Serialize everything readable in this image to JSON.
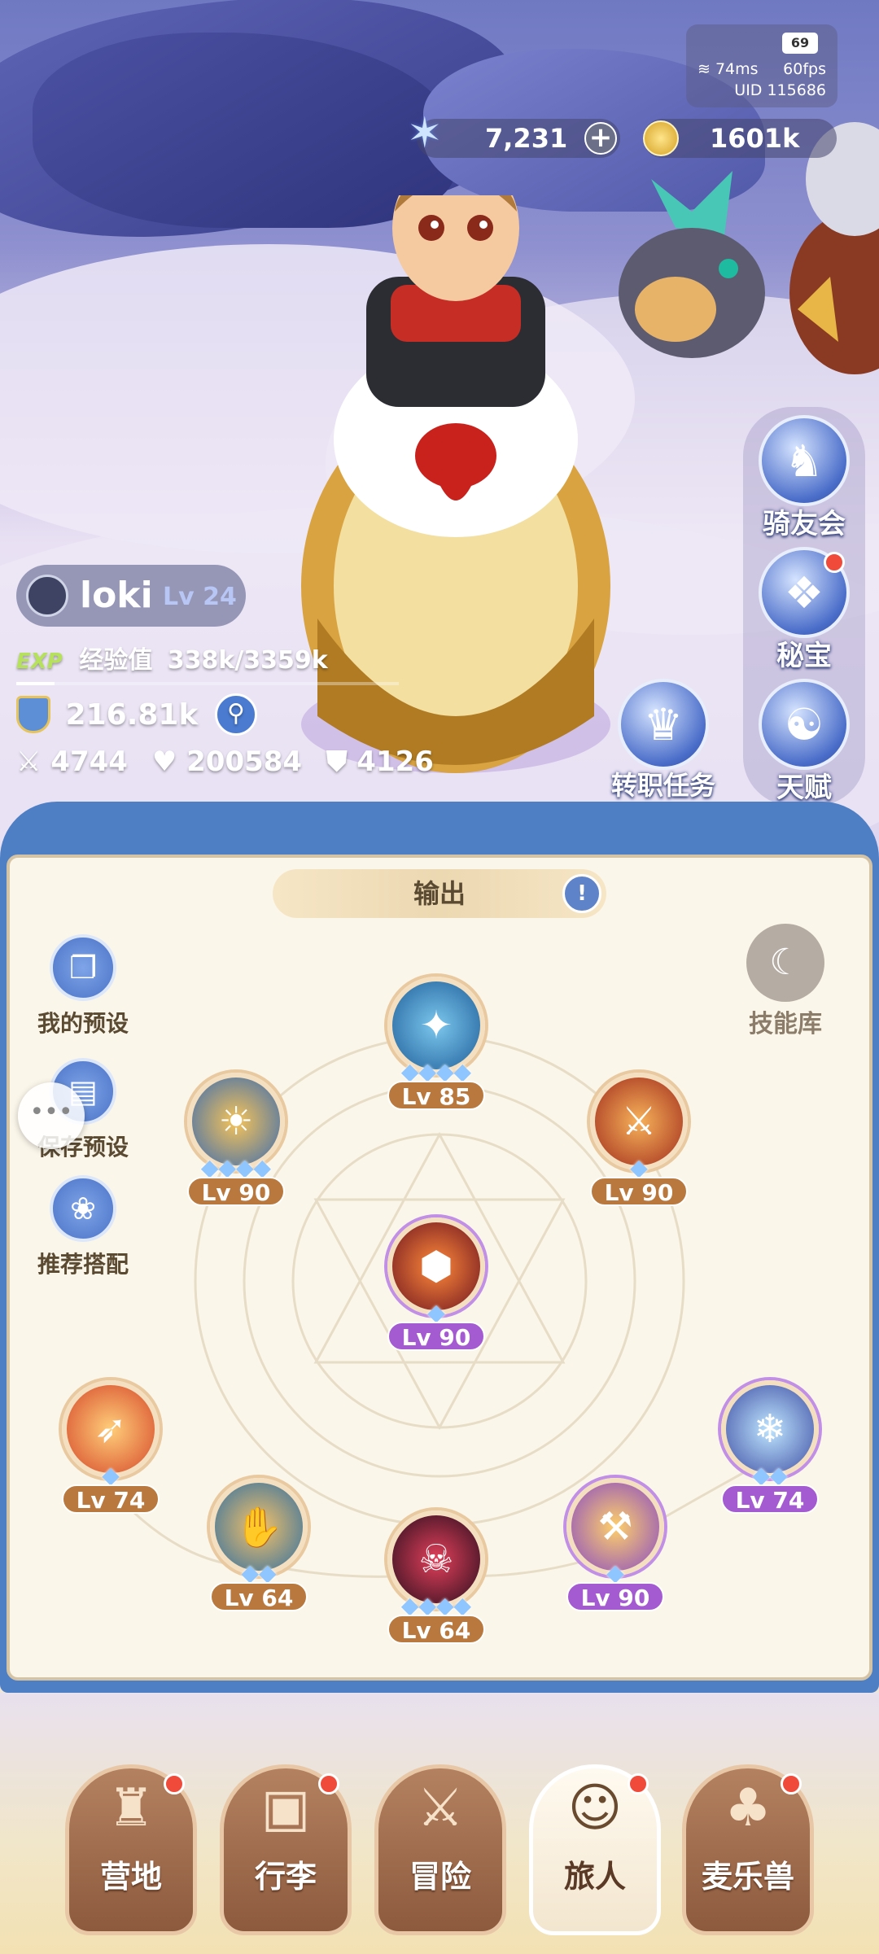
{
  "hud": {
    "battery": "69",
    "ping": "74ms",
    "fps": "60fps",
    "uid": "UID 115686",
    "gems": "7,231",
    "gold": "1601k"
  },
  "player": {
    "name": "loki",
    "level": "Lv 24",
    "exp_tag": "EXP",
    "exp_label": "经验值",
    "exp_value": "338k/3359k",
    "power": "216.81k",
    "attack": "4744",
    "hp": "200584",
    "defense": "4126"
  },
  "right_menu": [
    {
      "label": "骑友会",
      "icon": "horse-icon"
    },
    {
      "label": "秘宝",
      "icon": "treasure-icon"
    },
    {
      "label": "天赋",
      "icon": "talent-icon"
    }
  ],
  "job_quest": "转职任务",
  "panel": {
    "header": "输出",
    "left_buttons": [
      "我的预设",
      "保存预设",
      "推荐搭配"
    ],
    "skill_library": "技能库",
    "skills": [
      {
        "level": "Lv 85",
        "stars": "◆◆◆◆",
        "color": "#3a7fb8"
      },
      {
        "level": "Lv 90",
        "stars": "◆◆◆◆",
        "color": "#d88a2a"
      },
      {
        "level": "Lv 90",
        "stars": "◆",
        "color": "#d35a2a"
      },
      {
        "level": "Lv 90",
        "stars": "◆",
        "color": "#c0392b"
      },
      {
        "level": "Lv 74",
        "stars": "◆",
        "color": "#d9662e"
      },
      {
        "level": "Lv 64",
        "stars": "◆◆",
        "color": "#3f86b4"
      },
      {
        "level": "Lv 64",
        "stars": "◆◆◆◆",
        "color": "#8e1f2f"
      },
      {
        "level": "Lv 90",
        "stars": "◆",
        "color": "#e6922f"
      },
      {
        "level": "Lv 74",
        "stars": "◆◆",
        "color": "#4a8cc4"
      }
    ]
  },
  "nav": [
    "营地",
    "行李",
    "冒险",
    "旅人",
    "麦乐兽"
  ]
}
